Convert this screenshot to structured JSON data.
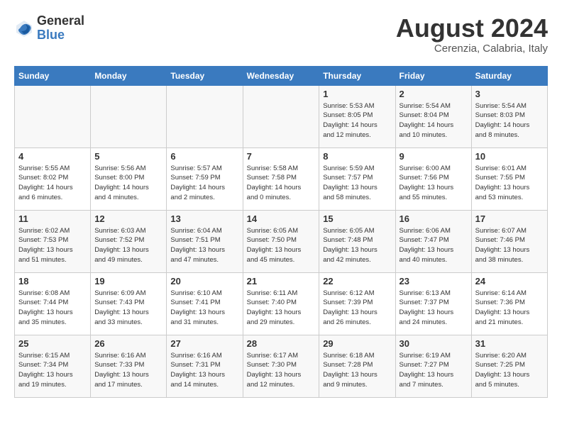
{
  "header": {
    "logo_line1": "General",
    "logo_line2": "Blue",
    "month": "August 2024",
    "location": "Cerenzia, Calabria, Italy"
  },
  "days_of_week": [
    "Sunday",
    "Monday",
    "Tuesday",
    "Wednesday",
    "Thursday",
    "Friday",
    "Saturday"
  ],
  "weeks": [
    [
      {
        "num": "",
        "info": ""
      },
      {
        "num": "",
        "info": ""
      },
      {
        "num": "",
        "info": ""
      },
      {
        "num": "",
        "info": ""
      },
      {
        "num": "1",
        "info": "Sunrise: 5:53 AM\nSunset: 8:05 PM\nDaylight: 14 hours\nand 12 minutes."
      },
      {
        "num": "2",
        "info": "Sunrise: 5:54 AM\nSunset: 8:04 PM\nDaylight: 14 hours\nand 10 minutes."
      },
      {
        "num": "3",
        "info": "Sunrise: 5:54 AM\nSunset: 8:03 PM\nDaylight: 14 hours\nand 8 minutes."
      }
    ],
    [
      {
        "num": "4",
        "info": "Sunrise: 5:55 AM\nSunset: 8:02 PM\nDaylight: 14 hours\nand 6 minutes."
      },
      {
        "num": "5",
        "info": "Sunrise: 5:56 AM\nSunset: 8:00 PM\nDaylight: 14 hours\nand 4 minutes."
      },
      {
        "num": "6",
        "info": "Sunrise: 5:57 AM\nSunset: 7:59 PM\nDaylight: 14 hours\nand 2 minutes."
      },
      {
        "num": "7",
        "info": "Sunrise: 5:58 AM\nSunset: 7:58 PM\nDaylight: 14 hours\nand 0 minutes."
      },
      {
        "num": "8",
        "info": "Sunrise: 5:59 AM\nSunset: 7:57 PM\nDaylight: 13 hours\nand 58 minutes."
      },
      {
        "num": "9",
        "info": "Sunrise: 6:00 AM\nSunset: 7:56 PM\nDaylight: 13 hours\nand 55 minutes."
      },
      {
        "num": "10",
        "info": "Sunrise: 6:01 AM\nSunset: 7:55 PM\nDaylight: 13 hours\nand 53 minutes."
      }
    ],
    [
      {
        "num": "11",
        "info": "Sunrise: 6:02 AM\nSunset: 7:53 PM\nDaylight: 13 hours\nand 51 minutes."
      },
      {
        "num": "12",
        "info": "Sunrise: 6:03 AM\nSunset: 7:52 PM\nDaylight: 13 hours\nand 49 minutes."
      },
      {
        "num": "13",
        "info": "Sunrise: 6:04 AM\nSunset: 7:51 PM\nDaylight: 13 hours\nand 47 minutes."
      },
      {
        "num": "14",
        "info": "Sunrise: 6:05 AM\nSunset: 7:50 PM\nDaylight: 13 hours\nand 45 minutes."
      },
      {
        "num": "15",
        "info": "Sunrise: 6:05 AM\nSunset: 7:48 PM\nDaylight: 13 hours\nand 42 minutes."
      },
      {
        "num": "16",
        "info": "Sunrise: 6:06 AM\nSunset: 7:47 PM\nDaylight: 13 hours\nand 40 minutes."
      },
      {
        "num": "17",
        "info": "Sunrise: 6:07 AM\nSunset: 7:46 PM\nDaylight: 13 hours\nand 38 minutes."
      }
    ],
    [
      {
        "num": "18",
        "info": "Sunrise: 6:08 AM\nSunset: 7:44 PM\nDaylight: 13 hours\nand 35 minutes."
      },
      {
        "num": "19",
        "info": "Sunrise: 6:09 AM\nSunset: 7:43 PM\nDaylight: 13 hours\nand 33 minutes."
      },
      {
        "num": "20",
        "info": "Sunrise: 6:10 AM\nSunset: 7:41 PM\nDaylight: 13 hours\nand 31 minutes."
      },
      {
        "num": "21",
        "info": "Sunrise: 6:11 AM\nSunset: 7:40 PM\nDaylight: 13 hours\nand 29 minutes."
      },
      {
        "num": "22",
        "info": "Sunrise: 6:12 AM\nSunset: 7:39 PM\nDaylight: 13 hours\nand 26 minutes."
      },
      {
        "num": "23",
        "info": "Sunrise: 6:13 AM\nSunset: 7:37 PM\nDaylight: 13 hours\nand 24 minutes."
      },
      {
        "num": "24",
        "info": "Sunrise: 6:14 AM\nSunset: 7:36 PM\nDaylight: 13 hours\nand 21 minutes."
      }
    ],
    [
      {
        "num": "25",
        "info": "Sunrise: 6:15 AM\nSunset: 7:34 PM\nDaylight: 13 hours\nand 19 minutes."
      },
      {
        "num": "26",
        "info": "Sunrise: 6:16 AM\nSunset: 7:33 PM\nDaylight: 13 hours\nand 17 minutes."
      },
      {
        "num": "27",
        "info": "Sunrise: 6:16 AM\nSunset: 7:31 PM\nDaylight: 13 hours\nand 14 minutes."
      },
      {
        "num": "28",
        "info": "Sunrise: 6:17 AM\nSunset: 7:30 PM\nDaylight: 13 hours\nand 12 minutes."
      },
      {
        "num": "29",
        "info": "Sunrise: 6:18 AM\nSunset: 7:28 PM\nDaylight: 13 hours\nand 9 minutes."
      },
      {
        "num": "30",
        "info": "Sunrise: 6:19 AM\nSunset: 7:27 PM\nDaylight: 13 hours\nand 7 minutes."
      },
      {
        "num": "31",
        "info": "Sunrise: 6:20 AM\nSunset: 7:25 PM\nDaylight: 13 hours\nand 5 minutes."
      }
    ]
  ]
}
